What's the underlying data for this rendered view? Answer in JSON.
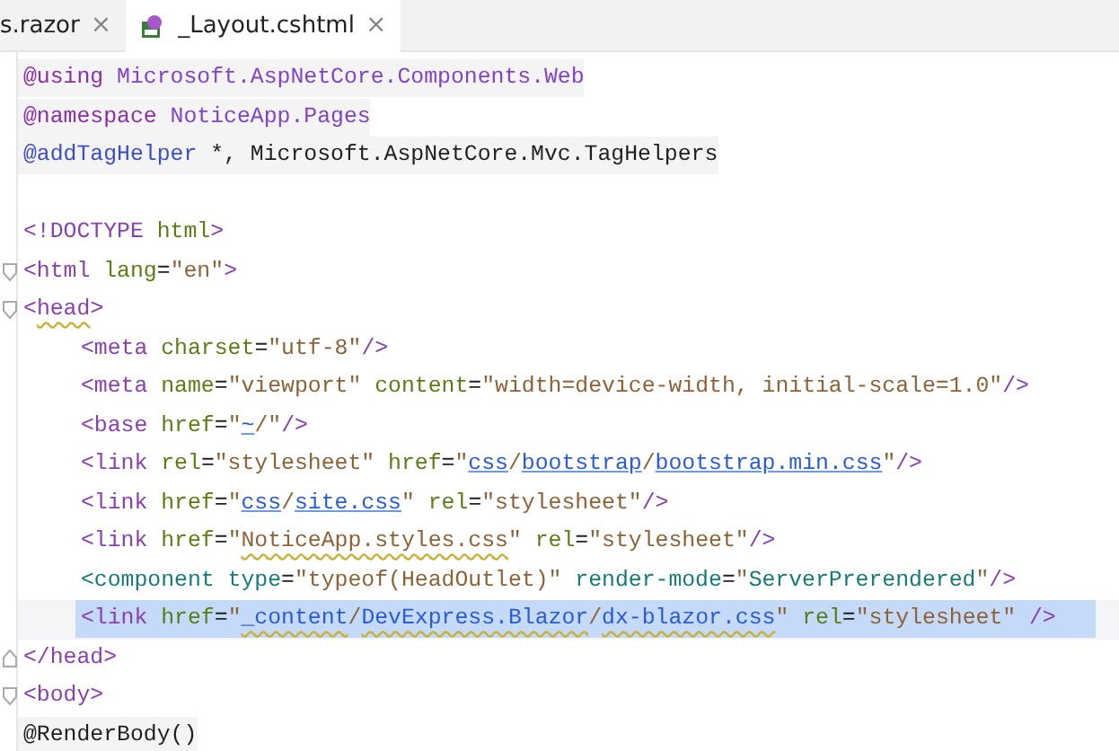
{
  "tabs": [
    {
      "label": "s.razor",
      "close": "×",
      "selected": false,
      "kind": "razor"
    },
    {
      "label": "_Layout.cshtml",
      "close": "×",
      "selected": true,
      "kind": "cshtml"
    }
  ],
  "lines": [
    {
      "kind": "razor",
      "tokens": [
        {
          "t": "@using",
          "kind": "dir"
        },
        {
          "t": " Microsoft.AspNetCore.Components.Web",
          "kind": "ns"
        }
      ]
    },
    {
      "kind": "razor",
      "tokens": [
        {
          "t": "@namespace",
          "kind": "dir"
        },
        {
          "t": " NoticeApp.Pages",
          "kind": "ns"
        }
      ]
    },
    {
      "kind": "razor",
      "tokens": [
        {
          "t": "@addTagHelper",
          "kind": "dir2"
        },
        {
          "t": " *, Microsoft.AspNetCore.Mvc.TagHelpers",
          "kind": "plain"
        }
      ]
    },
    {
      "kind": "blank"
    },
    {
      "kind": "code",
      "tokens": [
        {
          "t": "<!DOCTYPE",
          "kind": "tag"
        },
        {
          "t": " html",
          "kind": "attr"
        },
        {
          "t": ">",
          "kind": "tag"
        }
      ]
    },
    {
      "kind": "code",
      "fold_start": true,
      "tokens": [
        {
          "t": "<html",
          "kind": "tag"
        },
        {
          "t": " lang",
          "kind": "attr"
        },
        {
          "t": "=",
          "kind": "plain"
        },
        {
          "t": "\"en\"",
          "kind": "str"
        },
        {
          "t": ">",
          "kind": "tag"
        }
      ]
    },
    {
      "kind": "code",
      "fold_start": true,
      "tokens": [
        {
          "t": "<",
          "kind": "tag"
        },
        {
          "t": "head",
          "kind": "tag",
          "warn": true
        },
        {
          "t": ">",
          "kind": "tag"
        }
      ],
      "children": [
        {
          "kind": "code",
          "tokens": [
            {
              "t": "<meta",
              "kind": "tag"
            },
            {
              "t": " charset",
              "kind": "attr"
            },
            {
              "t": "=",
              "kind": "plain"
            },
            {
              "t": "\"utf-8\"",
              "kind": "str"
            },
            {
              "t": "/>",
              "kind": "tag"
            }
          ]
        },
        {
          "kind": "code",
          "tokens": [
            {
              "t": "<meta",
              "kind": "tag"
            },
            {
              "t": " name",
              "kind": "attr"
            },
            {
              "t": "=",
              "kind": "plain"
            },
            {
              "t": "\"viewport\"",
              "kind": "str"
            },
            {
              "t": " content",
              "kind": "attr"
            },
            {
              "t": "=",
              "kind": "plain"
            },
            {
              "t": "\"width=device-width, initial-scale=1.0\"",
              "kind": "str"
            },
            {
              "t": "/>",
              "kind": "tag"
            }
          ]
        },
        {
          "kind": "code",
          "tokens": [
            {
              "t": "<base",
              "kind": "tag"
            },
            {
              "t": " href",
              "kind": "attr"
            },
            {
              "t": "=",
              "kind": "plain"
            },
            {
              "t": "\"",
              "kind": "str"
            },
            {
              "t": "~",
              "kind": "str",
              "link": true
            },
            {
              "t": "/\"",
              "kind": "str"
            },
            {
              "t": "/>",
              "kind": "tag"
            }
          ]
        },
        {
          "kind": "code",
          "tokens": [
            {
              "t": "<link",
              "kind": "tag"
            },
            {
              "t": " rel",
              "kind": "attr"
            },
            {
              "t": "=",
              "kind": "plain"
            },
            {
              "t": "\"stylesheet\"",
              "kind": "str"
            },
            {
              "t": " href",
              "kind": "attr"
            },
            {
              "t": "=",
              "kind": "plain"
            },
            {
              "t": "\"",
              "kind": "str"
            },
            {
              "t": "css",
              "kind": "str",
              "link": true
            },
            {
              "t": "/",
              "kind": "str"
            },
            {
              "t": "bootstrap",
              "kind": "str",
              "link": true
            },
            {
              "t": "/",
              "kind": "str"
            },
            {
              "t": "bootstrap.min.css",
              "kind": "str",
              "link": true
            },
            {
              "t": "\"",
              "kind": "str"
            },
            {
              "t": "/>",
              "kind": "tag"
            }
          ]
        },
        {
          "kind": "code",
          "tokens": [
            {
              "t": "<link",
              "kind": "tag"
            },
            {
              "t": " href",
              "kind": "attr"
            },
            {
              "t": "=",
              "kind": "plain"
            },
            {
              "t": "\"",
              "kind": "str"
            },
            {
              "t": "css",
              "kind": "str",
              "link": true
            },
            {
              "t": "/",
              "kind": "str"
            },
            {
              "t": "site.css",
              "kind": "str",
              "link": true
            },
            {
              "t": "\"",
              "kind": "str"
            },
            {
              "t": " rel",
              "kind": "attr"
            },
            {
              "t": "=",
              "kind": "plain"
            },
            {
              "t": "\"stylesheet\"",
              "kind": "str"
            },
            {
              "t": "/>",
              "kind": "tag"
            }
          ]
        },
        {
          "kind": "code",
          "tokens": [
            {
              "t": "<link",
              "kind": "tag"
            },
            {
              "t": " href",
              "kind": "attr"
            },
            {
              "t": "=",
              "kind": "plain"
            },
            {
              "t": "\"",
              "kind": "str"
            },
            {
              "t": "NoticeApp.styles.css",
              "kind": "str",
              "warn": true
            },
            {
              "t": "\"",
              "kind": "str"
            },
            {
              "t": " rel",
              "kind": "attr"
            },
            {
              "t": "=",
              "kind": "plain"
            },
            {
              "t": "\"stylesheet\"",
              "kind": "str"
            },
            {
              "t": "/>",
              "kind": "tag"
            }
          ]
        },
        {
          "kind": "code",
          "tokens": [
            {
              "t": "<component",
              "kind": "comp"
            },
            {
              "t": " type",
              "kind": "comp"
            },
            {
              "t": "=",
              "kind": "plain"
            },
            {
              "t": "\"typeof(HeadOutlet)\"",
              "kind": "str"
            },
            {
              "t": " render-mode",
              "kind": "comp"
            },
            {
              "t": "=",
              "kind": "plain"
            },
            {
              "t": "\"",
              "kind": "str"
            },
            {
              "t": "ServerPrerendered",
              "kind": "comp"
            },
            {
              "t": "\"",
              "kind": "str"
            },
            {
              "t": "/>",
              "kind": "tag"
            }
          ]
        },
        {
          "kind": "code",
          "selected": true,
          "tokens": [
            {
              "t": "<link",
              "kind": "tag"
            },
            {
              "t": " href",
              "kind": "attr"
            },
            {
              "t": "=",
              "kind": "plain"
            },
            {
              "t": "\"",
              "kind": "str"
            },
            {
              "t": "_content",
              "kind": "str",
              "link": true,
              "warn": true
            },
            {
              "t": "/",
              "kind": "str"
            },
            {
              "t": "DevExpress.Blazor",
              "kind": "str",
              "link": true,
              "warn": true
            },
            {
              "t": "/",
              "kind": "str"
            },
            {
              "t": "dx-blazor.css",
              "kind": "str",
              "link": true,
              "warn": true
            },
            {
              "t": "\"",
              "kind": "str"
            },
            {
              "t": " rel",
              "kind": "attr"
            },
            {
              "t": "=",
              "kind": "plain"
            },
            {
              "t": "\"stylesheet\"",
              "kind": "str"
            },
            {
              "t": " />",
              "kind": "tag"
            }
          ]
        }
      ]
    },
    {
      "kind": "code",
      "fold_end": true,
      "tokens": [
        {
          "t": "</head>",
          "kind": "tag"
        }
      ]
    },
    {
      "kind": "code",
      "fold_start": true,
      "tokens": [
        {
          "t": "<body>",
          "kind": "tag"
        }
      ]
    },
    {
      "kind": "razor",
      "tokens": [
        {
          "t": "@RenderBody()",
          "kind": "plain"
        }
      ]
    }
  ]
}
